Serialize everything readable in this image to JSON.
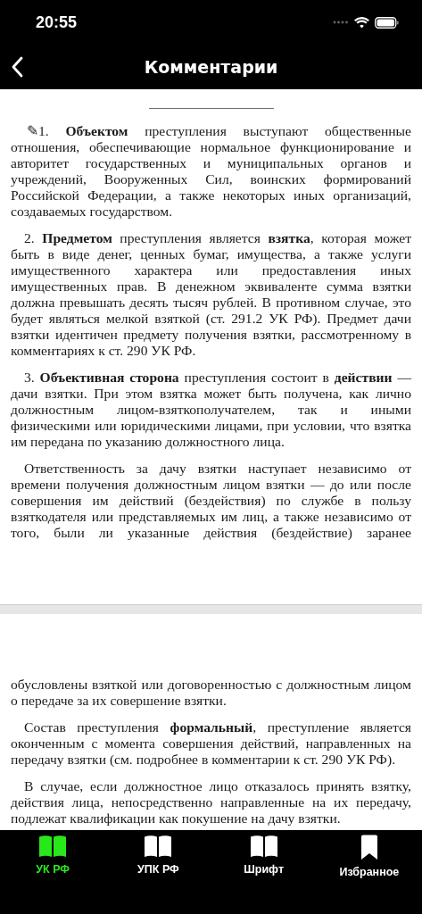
{
  "status_bar": {
    "time": "20:55"
  },
  "nav": {
    "title": "Комментарии"
  },
  "pages": [
    {
      "paragraphs": [
        "✎1. **Объектом** преступления выступают общественные отношения, обеспечивающие нормальное функционирование и авторитет государственных и муниципальных органов и учреждений, Вооруженных Сил, воинских формирований Российской Федерации, а также некоторых иных организаций, создаваемых государством.",
        "2. **Предметом** преступления является **взятка**, которая может быть в виде денег, ценных бумаг, имущества, а также услуги имущественного характера или предоставления иных имущественных прав. В денежном эквиваленте сумма взятки должна превышать десять тысяч рублей. В противном случае, это будет являться мелкой взяткой (ст. 291.2 УК РФ). Предмет дачи взятки идентичен предмету получения взятки, рассмотренному в комментариях к ст. 290 УК РФ.",
        "3. **Объективная сторона** преступления состоит в **действии** — дачи взятки. При этом взятка может быть получена, как лично должностным лицом-взяткополучателем, так и иными физическими или юридическими лицами, при условии, что взятка им передана по указанию должностного лица.",
        "Ответственность за дачу взятки наступает независимо от времени получения должностным лицом взятки — до или после совершения им действий (бездействия) по службе в пользу взяткодателя или представляемых им лиц, а также независимо от того, были ли указанные действия (бездействие) заранее"
      ]
    },
    {
      "paragraphs": [
        "обусловлены взяткой или договоренностью с должностным лицом о передаче за их совершение взятки.",
        "Состав преступления **формальный**, преступление является оконченным с момента совершения действий, направленных на передачу взятки (см. подробнее в комментарии к ст. 290 УК РФ).",
        "В случае, если должностное лицо отказалось принять взятку, действия лица, непосредственно направленные на их передачу, подлежат квалификации как покушение на дачу взятки."
      ]
    }
  ],
  "tabs": [
    {
      "label": "УК РФ",
      "kind": "book",
      "selected": true
    },
    {
      "label": "УПК РФ",
      "kind": "book",
      "selected": false
    },
    {
      "label": "Шрифт",
      "kind": "book",
      "selected": false
    },
    {
      "label": "Избранное",
      "kind": "bookmark",
      "selected": false
    }
  ]
}
